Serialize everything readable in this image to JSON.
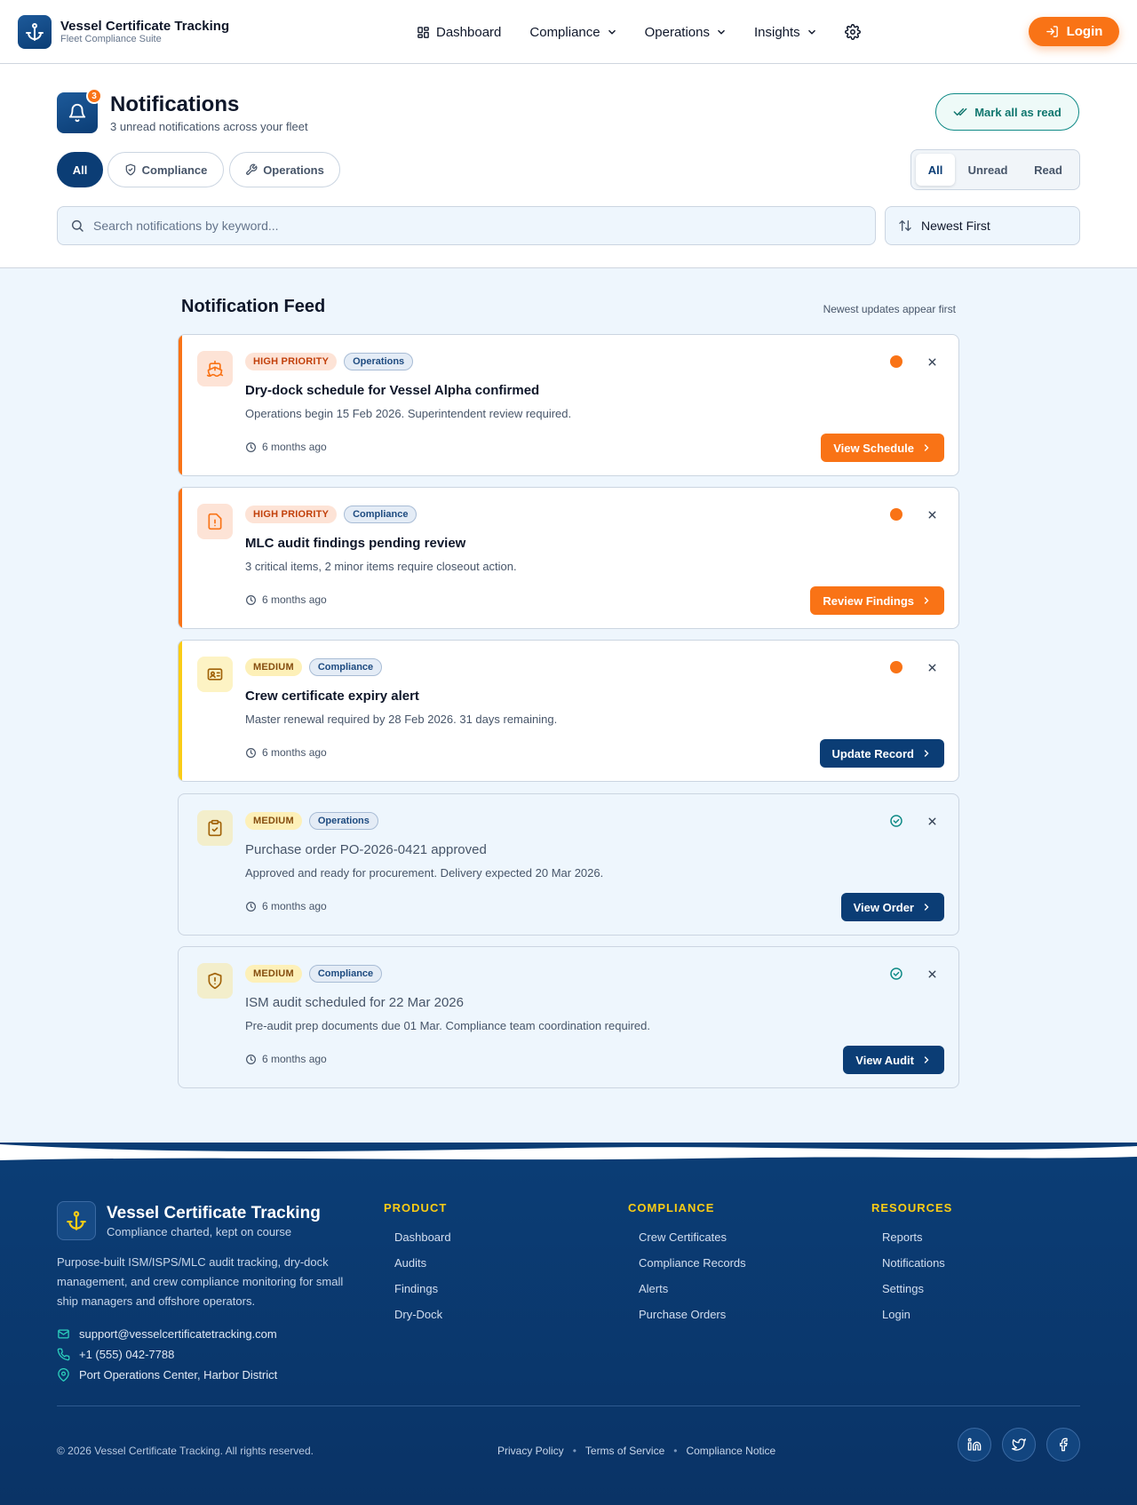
{
  "app": {
    "title": "Vessel Certificate Tracking",
    "subtitle": "Fleet Compliance Suite"
  },
  "nav": {
    "items": [
      {
        "label": "Dashboard",
        "icon": "dashboard-icon"
      },
      {
        "label": "Compliance",
        "icon": "chevron-down-icon"
      },
      {
        "label": "Operations",
        "icon": "chevron-down-icon"
      },
      {
        "label": "Insights",
        "icon": "chevron-down-icon"
      }
    ],
    "settings_icon": "gear-icon",
    "login_label": "Login"
  },
  "header": {
    "title": "Notifications",
    "subtitle": "3 unread notifications across your fleet",
    "badge_count": "3",
    "mark_all_label": "Mark all as read"
  },
  "filters": {
    "categories": [
      "All",
      "Compliance",
      "Operations"
    ],
    "active_category": "All",
    "read_states": [
      "All",
      "Unread",
      "Read"
    ],
    "active_read_state": "All"
  },
  "search": {
    "placeholder": "Search notifications by keyword..."
  },
  "sort": {
    "value": "Newest First"
  },
  "feed": {
    "title": "Notification Feed",
    "hint": "Newest updates appear first",
    "items": [
      {
        "priority": "HIGH PRIORITY",
        "category": "Operations",
        "title": "Dry-dock schedule for Vessel Alpha confirmed",
        "description": "Operations begin 15 Feb 2026. Superintendent review required.",
        "time": "6 months ago",
        "action": "View Schedule",
        "status": "unread",
        "icon": "ship-icon"
      },
      {
        "priority": "HIGH PRIORITY",
        "category": "Compliance",
        "title": "MLC audit findings pending review",
        "description": "3 critical items, 2 minor items require closeout action.",
        "time": "6 months ago",
        "action": "Review Findings",
        "status": "unread",
        "icon": "alert-file-icon"
      },
      {
        "priority": "MEDIUM",
        "category": "Compliance",
        "title": "Crew certificate expiry alert",
        "description": "Master renewal required by 28 Feb 2026. 31 days remaining.",
        "time": "6 months ago",
        "action": "Update Record",
        "status": "unread",
        "icon": "id-card-icon"
      },
      {
        "priority": "MEDIUM",
        "category": "Operations",
        "title": "Purchase order PO-2026-0421 approved",
        "description": "Approved and ready for procurement. Delivery expected 20 Mar 2026.",
        "time": "6 months ago",
        "action": "View Order",
        "status": "read",
        "icon": "clipboard-check-icon"
      },
      {
        "priority": "MEDIUM",
        "category": "Compliance",
        "title": "ISM audit scheduled for 22 Mar 2026",
        "description": "Pre-audit prep documents due 01 Mar. Compliance team coordination required.",
        "time": "6 months ago",
        "action": "View Audit",
        "status": "read",
        "icon": "shield-alert-icon"
      }
    ]
  },
  "footer": {
    "title": "Vessel Certificate Tracking",
    "tagline": "Compliance charted, kept on course",
    "description": "Purpose-built ISM/ISPS/MLC audit tracking, dry-dock management, and crew compliance monitoring for small ship managers and offshore operators.",
    "email": "support@vesselcertificatetracking.com",
    "phone": "+1 (555) 042-7788",
    "address": "Port Operations Center, Harbor District",
    "columns": [
      {
        "heading": "PRODUCT",
        "links": [
          "Dashboard",
          "Audits",
          "Findings",
          "Dry-Dock"
        ]
      },
      {
        "heading": "COMPLIANCE",
        "links": [
          "Crew Certificates",
          "Compliance Records",
          "Alerts",
          "Purchase Orders"
        ]
      },
      {
        "heading": "RESOURCES",
        "links": [
          "Reports",
          "Notifications",
          "Settings",
          "Login"
        ]
      }
    ],
    "copyright": "© 2026 Vessel Certificate Tracking. All rights reserved.",
    "legal": [
      "Privacy Policy",
      "Terms of Service",
      "Compliance Notice"
    ],
    "social": [
      "linkedin-icon",
      "twitter-icon",
      "facebook-icon"
    ]
  },
  "colors": {
    "navy": "#0b3d75",
    "orange": "#f97316",
    "teal": "#0f8a86",
    "yellow": "#facc15",
    "page_bg": "#eef6fd"
  }
}
